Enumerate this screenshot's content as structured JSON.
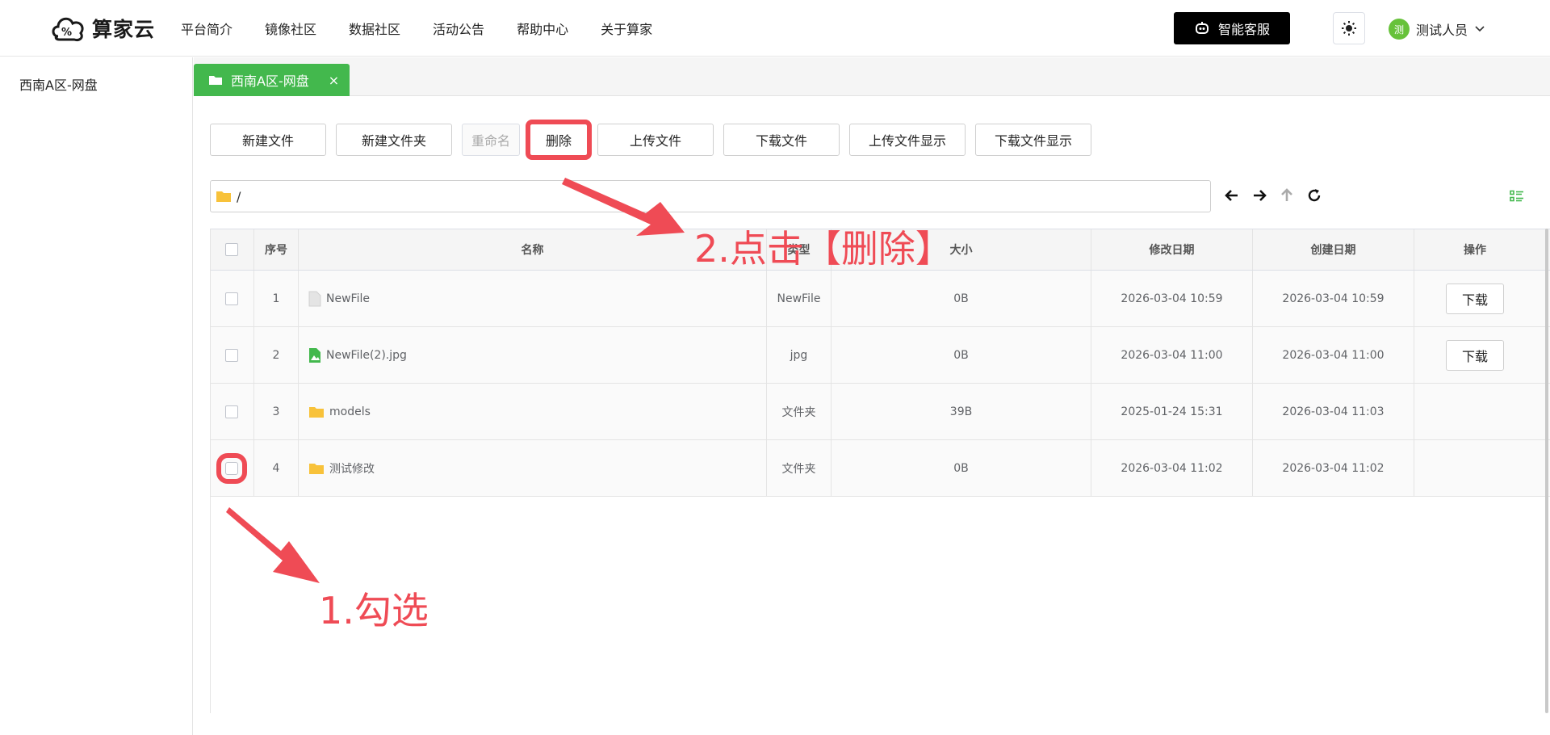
{
  "brand": {
    "name": "算家云"
  },
  "nav": [
    "平台简介",
    "镜像社区",
    "数据社区",
    "活动公告",
    "帮助中心",
    "关于算家"
  ],
  "header": {
    "service_label": "智能客服",
    "user_initial": "测",
    "user_name": "测试人员"
  },
  "sidebar": {
    "items": [
      "西南A区-网盘"
    ]
  },
  "tab": {
    "label": "西南A区-网盘",
    "close": "×"
  },
  "toolbar": {
    "new_file": "新建文件",
    "new_folder": "新建文件夹",
    "rename": "重命名",
    "delete": "删除",
    "upload": "上传文件",
    "download": "下载文件",
    "upload_show": "上传文件显示",
    "download_show": "下载文件显示"
  },
  "path": {
    "value": "/"
  },
  "table": {
    "headers": [
      "序号",
      "名称",
      "类型",
      "大小",
      "修改日期",
      "创建日期",
      "操作"
    ],
    "rows": [
      {
        "index": "1",
        "name": "NewFile",
        "type": "NewFile",
        "size": "0B",
        "modified": "2026-03-04 10:59",
        "created": "2026-03-04 10:59",
        "action": "下载"
      },
      {
        "index": "2",
        "name": "NewFile(2).jpg",
        "type": "jpg",
        "size": "0B",
        "modified": "2026-03-04 11:00",
        "created": "2026-03-04 11:00",
        "action": "下载"
      },
      {
        "index": "3",
        "name": "models",
        "type": "文件夹",
        "size": "39B",
        "modified": "2025-01-24 15:31",
        "created": "2026-03-04 11:03",
        "action": ""
      },
      {
        "index": "4",
        "name": "测试修改",
        "type": "文件夹",
        "size": "0B",
        "modified": "2026-03-04 11:02",
        "created": "2026-03-04 11:02",
        "action": ""
      }
    ]
  },
  "annotations": {
    "step1": "1.勾选",
    "step2": "2.点击【删除】"
  },
  "colors": {
    "accent_green": "#43b84d",
    "annotation_red": "#ef4b55",
    "folder_yellow": "#f8c23a"
  }
}
